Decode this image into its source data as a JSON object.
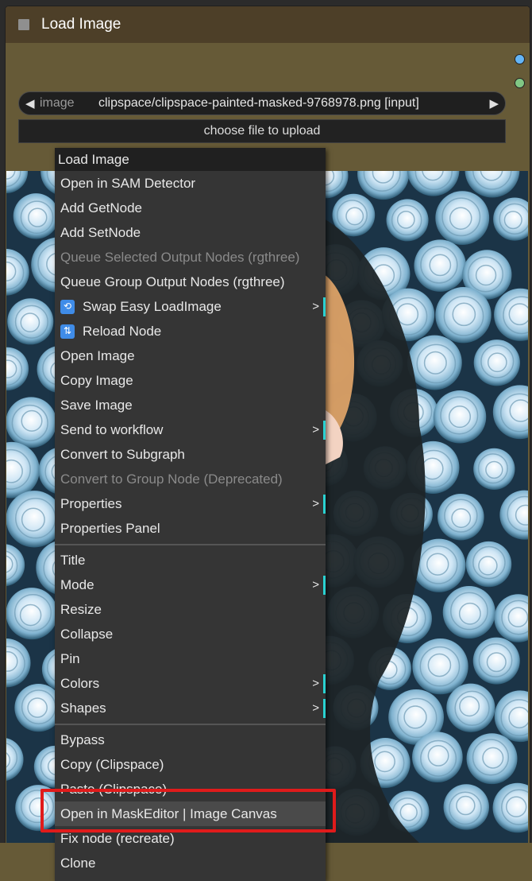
{
  "node": {
    "title": "Load Image",
    "combo_label": "image",
    "combo_value": "clipspace/clipspace-painted-masked-9768978.png [input]",
    "upload_button": "choose file to upload",
    "output_slot_colors": [
      "#64b5f6",
      "#81c784"
    ]
  },
  "menu": {
    "title": "Load Image",
    "group1": [
      {
        "label": "Open in SAM Detector",
        "disabled": false
      },
      {
        "label": "Add GetNode",
        "disabled": false
      },
      {
        "label": "Add SetNode",
        "disabled": false
      },
      {
        "label": "Queue Selected Output Nodes (rgthree)",
        "disabled": true
      },
      {
        "label": "Queue Group Output Nodes (rgthree)",
        "disabled": false
      },
      {
        "label": "Swap Easy LoadImage",
        "disabled": false,
        "icon": "swap-icon",
        "submenu": true
      },
      {
        "label": "Reload Node",
        "disabled": false,
        "icon": "reload-icon"
      },
      {
        "label": "Open Image",
        "disabled": false
      },
      {
        "label": "Copy Image",
        "disabled": false
      },
      {
        "label": "Save Image",
        "disabled": false
      },
      {
        "label": "Send to workflow",
        "disabled": false,
        "submenu": true
      },
      {
        "label": "Convert to Subgraph",
        "disabled": false
      },
      {
        "label": "Convert to Group Node (Deprecated)",
        "disabled": true
      },
      {
        "label": "Properties",
        "disabled": false,
        "submenu": true
      },
      {
        "label": "Properties Panel",
        "disabled": false
      }
    ],
    "group2": [
      {
        "label": "Title",
        "submenu": false
      },
      {
        "label": "Mode",
        "submenu": true
      },
      {
        "label": "Resize",
        "submenu": false
      },
      {
        "label": "Collapse",
        "submenu": false
      },
      {
        "label": "Pin",
        "submenu": false
      },
      {
        "label": "Colors",
        "submenu": true
      },
      {
        "label": "Shapes",
        "submenu": true
      }
    ],
    "group3": [
      {
        "label": "Bypass"
      },
      {
        "label": "Copy (Clipspace)"
      },
      {
        "label": "Paste (Clipspace)"
      },
      {
        "label": "Open in MaskEditor | Image Canvas",
        "highlighted": true
      },
      {
        "label": "Fix node (recreate)"
      },
      {
        "label": "Clone"
      }
    ]
  },
  "annotation_color": "#e01b1b",
  "submenu_indicator_color": "#2ad1d1"
}
